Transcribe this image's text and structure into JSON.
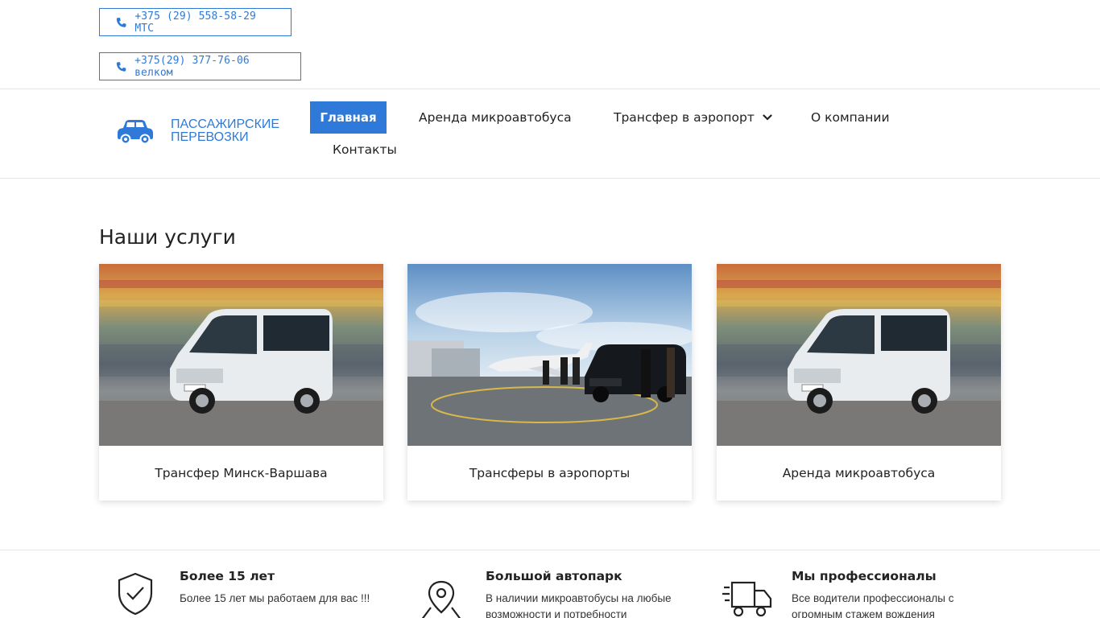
{
  "top_bar": {
    "phones": [
      {
        "label": "+375 (29) 558-58-29 МТС",
        "icon": "phone-icon"
      },
      {
        "label": "+375(29) 377-76-06 велком",
        "icon": "phone-icon"
      }
    ]
  },
  "header": {
    "logo_text": "ПАССАЖИРСКИЕ ПЕРЕВОЗКИ",
    "logo_icon": "car-icon",
    "nav": {
      "home": "Главная",
      "rent": "Аренда микроавтобуса",
      "transfer": "Трансфер в аэропорт",
      "about": "О компании",
      "contacts": "Контакты"
    }
  },
  "services": {
    "title": "Наши услуги",
    "cards": [
      {
        "caption": "Трансфер Минск-Варшава",
        "image": "white-minibus-photo"
      },
      {
        "caption": "Трансферы в аэропорты",
        "image": "airport-jet-van-photo"
      },
      {
        "caption": "Аренда микроавтобуса",
        "image": "white-minibus-photo"
      }
    ]
  },
  "features": [
    {
      "title": "Более 15 лет",
      "text": "Более 15 лет мы работаем для вас !!!",
      "icon": "shield-check-icon"
    },
    {
      "title": "Большой автопарк",
      "text": "В наличии микроавтобусы на любые возможности и потребности",
      "icon": "map-pin-icon"
    },
    {
      "title": "Мы профессионалы",
      "text": "Все водители профессионалы с огромным стажем вождения",
      "icon": "delivery-truck-icon"
    }
  ],
  "colors": {
    "accent": "#2f7ad9",
    "text": "#222222",
    "divider": "#e6e6e6"
  }
}
